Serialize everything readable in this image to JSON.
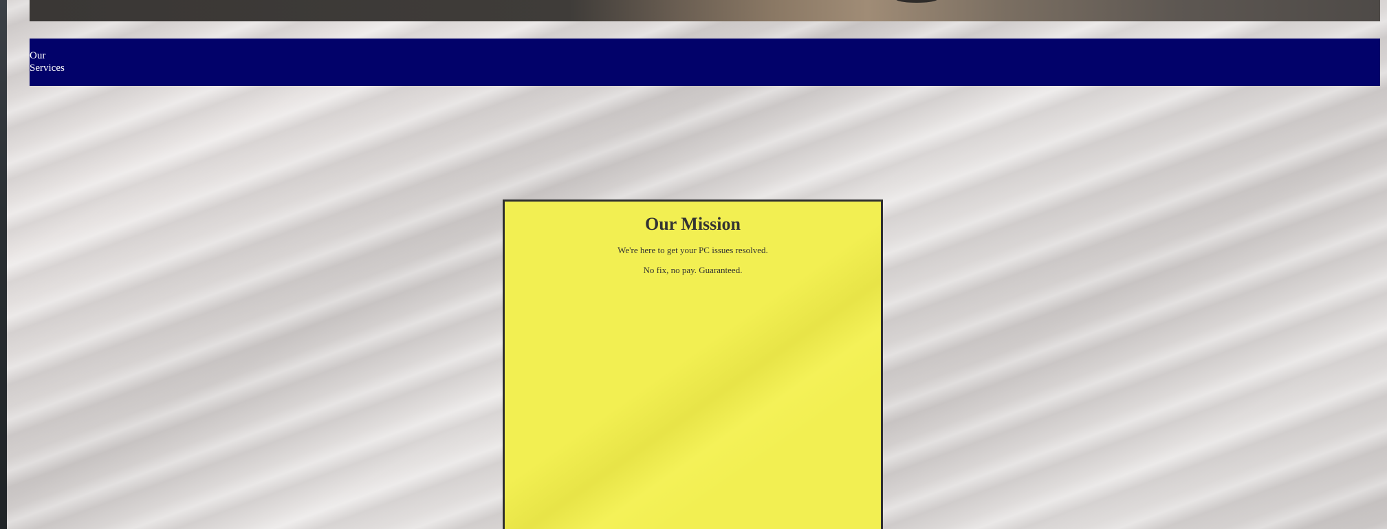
{
  "nav": {
    "services_label_line1": "Our",
    "services_label_line2": "Services"
  },
  "mission": {
    "title": "Our Mission",
    "line1": "We're here to get your PC issues resolved.",
    "line2": "No fix, no pay. Guaranteed."
  },
  "colors": {
    "nav_bar": "#02026a",
    "mission_card": "#f2ef52",
    "mission_text": "#333333"
  }
}
